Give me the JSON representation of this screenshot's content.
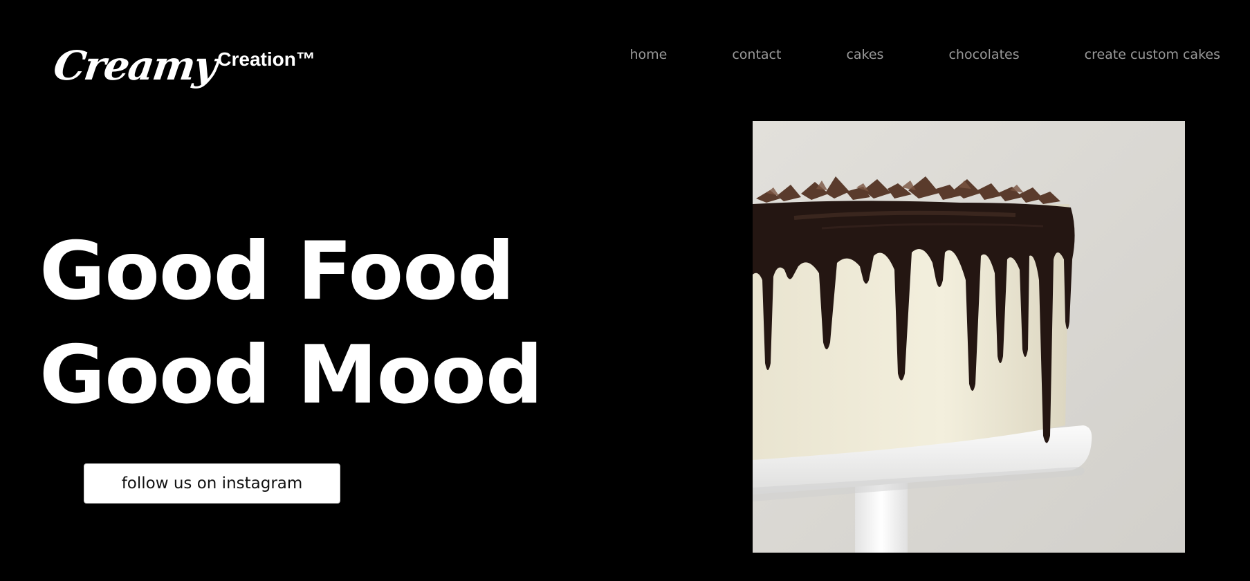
{
  "brand": {
    "logo_script": "Creamy",
    "logo_rest": "Creation™"
  },
  "nav": {
    "items": [
      {
        "label": "home"
      },
      {
        "label": "contact"
      },
      {
        "label": "cakes"
      },
      {
        "label": "chocolates"
      },
      {
        "label": "create custom cakes"
      }
    ]
  },
  "hero": {
    "headline_line1": "Good Food",
    "headline_line2": "Good Mood",
    "cta_label": "follow us on instagram",
    "image_icon": "cake-photo"
  },
  "colors": {
    "background": "#000000",
    "nav_text": "#9a9a9a",
    "headline": "#ffffff",
    "button_bg": "#ffffff",
    "button_text": "#111111"
  }
}
